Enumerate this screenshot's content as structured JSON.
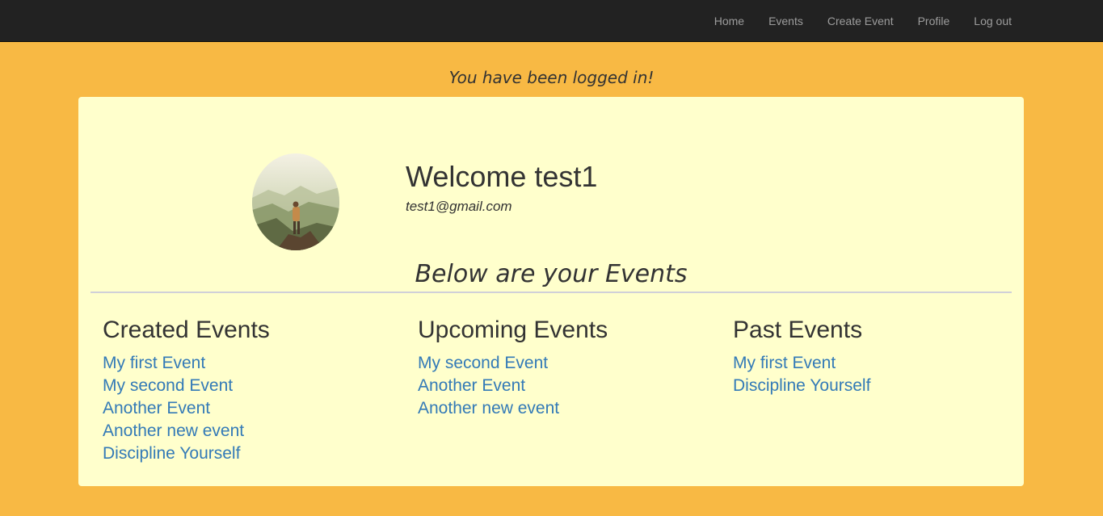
{
  "nav": {
    "items": [
      {
        "label": "Home"
      },
      {
        "label": "Events"
      },
      {
        "label": "Create Event"
      },
      {
        "label": "Profile"
      },
      {
        "label": "Log out"
      }
    ]
  },
  "flash": {
    "message": "You have been logged in!"
  },
  "profile": {
    "welcome": "Welcome test1",
    "email": "test1@gmail.com"
  },
  "events": {
    "section_title": "Below are your Events",
    "created": {
      "heading": "Created Events",
      "items": [
        "My first Event",
        "My second Event",
        "Another Event",
        "Another new event",
        "Discipline Yourself"
      ]
    },
    "upcoming": {
      "heading": "Upcoming Events",
      "items": [
        "My second Event",
        "Another Event",
        "Another new event"
      ]
    },
    "past": {
      "heading": "Past Events",
      "items": [
        "My first Event",
        "Discipline Yourself"
      ]
    }
  },
  "colors": {
    "background": "#f8b944",
    "navbar": "#222222",
    "card": "#ffffcc",
    "link": "#337ab7"
  }
}
